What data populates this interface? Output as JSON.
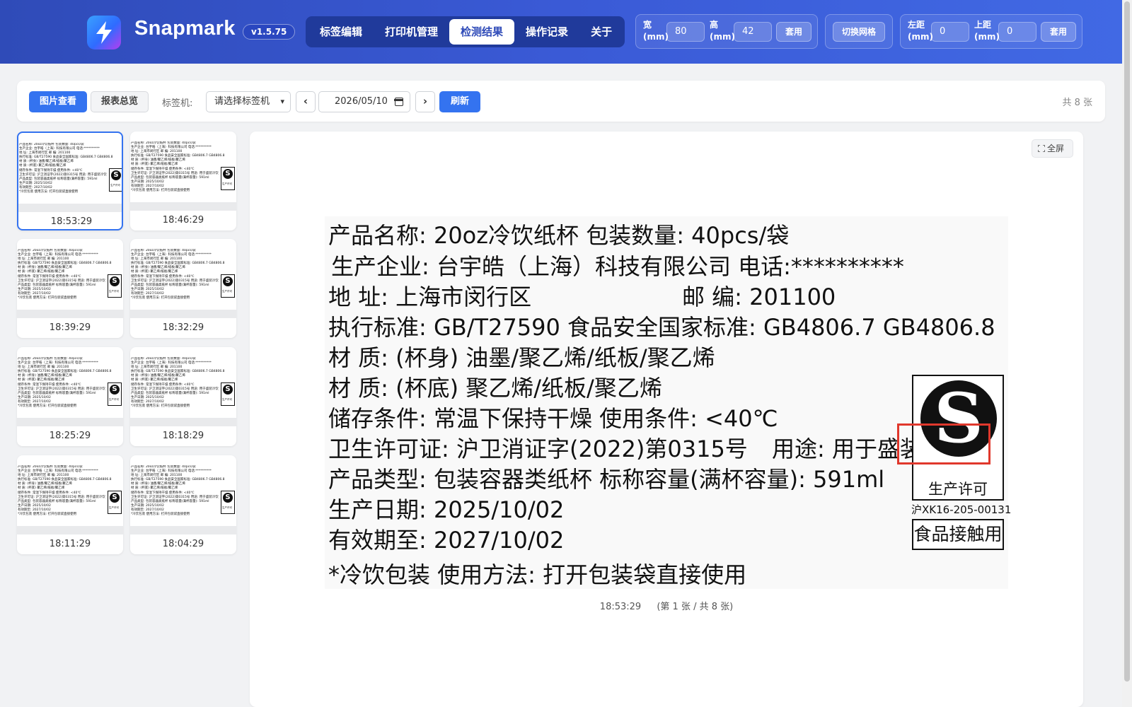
{
  "app": {
    "brand": "Snapmark",
    "version": "v1.5.75"
  },
  "nav": {
    "items": [
      {
        "label": "标签编辑"
      },
      {
        "label": "打印机管理"
      },
      {
        "label": "检测结果"
      },
      {
        "label": "操作记录"
      },
      {
        "label": "关于"
      }
    ],
    "active_index": 2
  },
  "size_settings": {
    "width_label": "宽",
    "width_unit": "(mm)",
    "width_value": "80",
    "height_label": "高",
    "height_unit": "(mm)",
    "height_value": "42",
    "apply_label": "套用"
  },
  "grid_toggle": {
    "label": "切换网格"
  },
  "margin_settings": {
    "left_label": "左距",
    "left_unit": "(mm)",
    "left_value": "0",
    "top_label": "上距",
    "top_unit": "(mm)",
    "top_value": "0",
    "apply_label": "套用"
  },
  "toolbar": {
    "image_view_label": "图片查看",
    "report_label": "报表总览",
    "printer_label": "标签机:",
    "printer_select": "请选择标签机",
    "prev": "‹",
    "next": "›",
    "date": "2026/05/10",
    "refresh_label": "刷新",
    "count": "共 8 张"
  },
  "thumbnails": [
    {
      "time": "18:53:29",
      "selected": true
    },
    {
      "time": "18:46:29",
      "selected": false
    },
    {
      "time": "18:39:29",
      "selected": false
    },
    {
      "time": "18:32:29",
      "selected": false
    },
    {
      "time": "18:25:29",
      "selected": false
    },
    {
      "time": "18:18:29",
      "selected": false
    },
    {
      "time": "18:11:29",
      "selected": false
    },
    {
      "time": "18:04:29",
      "selected": false
    }
  ],
  "thumbnail_text": [
    "产品名称: 20oz冷饮纸杯 包装数量: 40pcs/袋",
    "生产企业: 台宇皓（上海）科技有限公司 电话:**********",
    "地 址: 上海市闵行区           邮 编: 201100",
    "执行标准: GB/T27590 食品安全国家标准: GB4806.7 GB4806.8",
    "材 质: (杯身) 油墨/聚乙烯/纸板/聚乙烯",
    "材 质: (杯底) 聚乙烯/纸板/聚乙烯",
    "储存条件: 常温下保持干燥 使用条件: <40℃",
    "卫生许可证: 沪卫消证字(2022)第0315号      用途: 用于盛装冷饮",
    "产品类型: 包装容器类纸杯 标称容量(满杯容量): 591ml",
    "生产日期: 2025/10/02",
    "有效期至: 2027/10/02",
    "*冷饮包装 使用方法: 打开包装袋直接使用"
  ],
  "viewer": {
    "fullscreen_label": "全屏",
    "caption_time": "18:53:29",
    "caption_index": "(第 1 张 / 共 8 张)"
  },
  "label": {
    "lines": [
      "产品名称: 20oz冷饮纸杯 包装数量: 40pcs/袋",
      "生产企业: 台宇皓（上海）科技有限公司 电话:**********",
      "地 址: 上海市闵行区",
      "执行标准: GB/T27590 食品安全国家标准: GB4806.7 GB4806.8",
      "材 质: (杯身) 油墨/聚乙烯/纸板/聚乙烯",
      "材 质: (杯底) 聚乙烯/纸板/聚乙烯",
      "储存条件: 常温下保持干燥 使用条件: <40℃",
      "卫生许可证: 沪卫消证字(2022)第0315号",
      "产品类型: 包装容器类纸杯 标称容量(满杯容量): 591ml",
      "生产日期: 2025/10/02",
      "有效期至: 2027/10/02",
      "*冷饮包装 使用方法: 打开包装袋直接使用"
    ],
    "postcode": "邮 编: 201100",
    "usage": "用途: 用于盛装冷饮",
    "cert_mark": "S",
    "cert_text": "生产许可",
    "cert_number": "沪XK16-205-00131",
    "contact_text": "食品接触用"
  },
  "colors": {
    "accent": "#3473f0",
    "header": "#3a5ad6",
    "detection_box": "#e0382c"
  }
}
